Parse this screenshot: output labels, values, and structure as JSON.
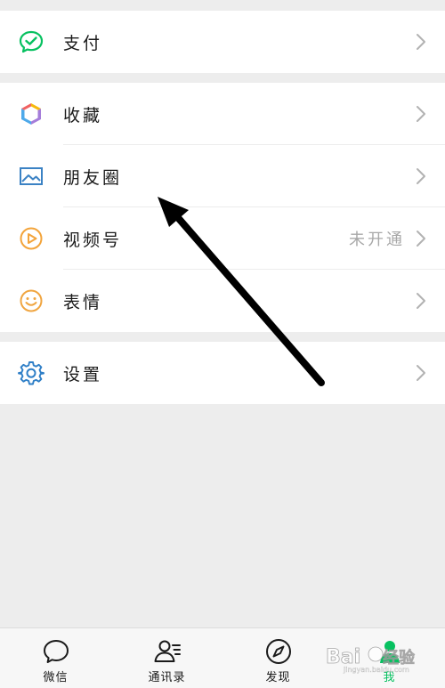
{
  "menu": {
    "pay": {
      "label": "支付"
    },
    "favorites": {
      "label": "收藏"
    },
    "moments": {
      "label": "朋友圈"
    },
    "channels": {
      "label": "视频号",
      "status": "未开通"
    },
    "stickers": {
      "label": "表情"
    },
    "settings": {
      "label": "设置"
    }
  },
  "tabbar": {
    "chats": "微信",
    "contacts": "通讯录",
    "discover": "发现",
    "me": "我"
  },
  "watermark": {
    "text": "Bai经验",
    "sub": "jingyan.baidu.com"
  },
  "colors": {
    "wechat_green": "#07c160",
    "moments_blue": "#3b82c4",
    "channels_orange": "#f3a43b",
    "sticker_orange": "#f0a540",
    "settings_blue": "#2f7fc7",
    "background": "#ededed"
  }
}
